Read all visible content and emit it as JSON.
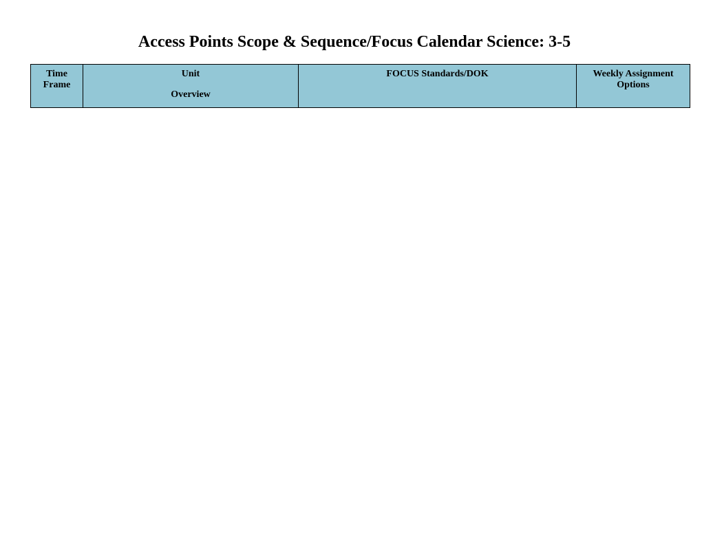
{
  "title": "Access Points Scope & Sequence/Focus Calendar Science: 3-5",
  "columns": {
    "time_line1": "Time",
    "time_line2": "Frame",
    "unit_line1": "Unit",
    "unit_line2": "Overview",
    "focus": "FOCUS Standards/DOK",
    "weekly_line1": "Weekly Assignment",
    "weekly_line2": "Options"
  }
}
